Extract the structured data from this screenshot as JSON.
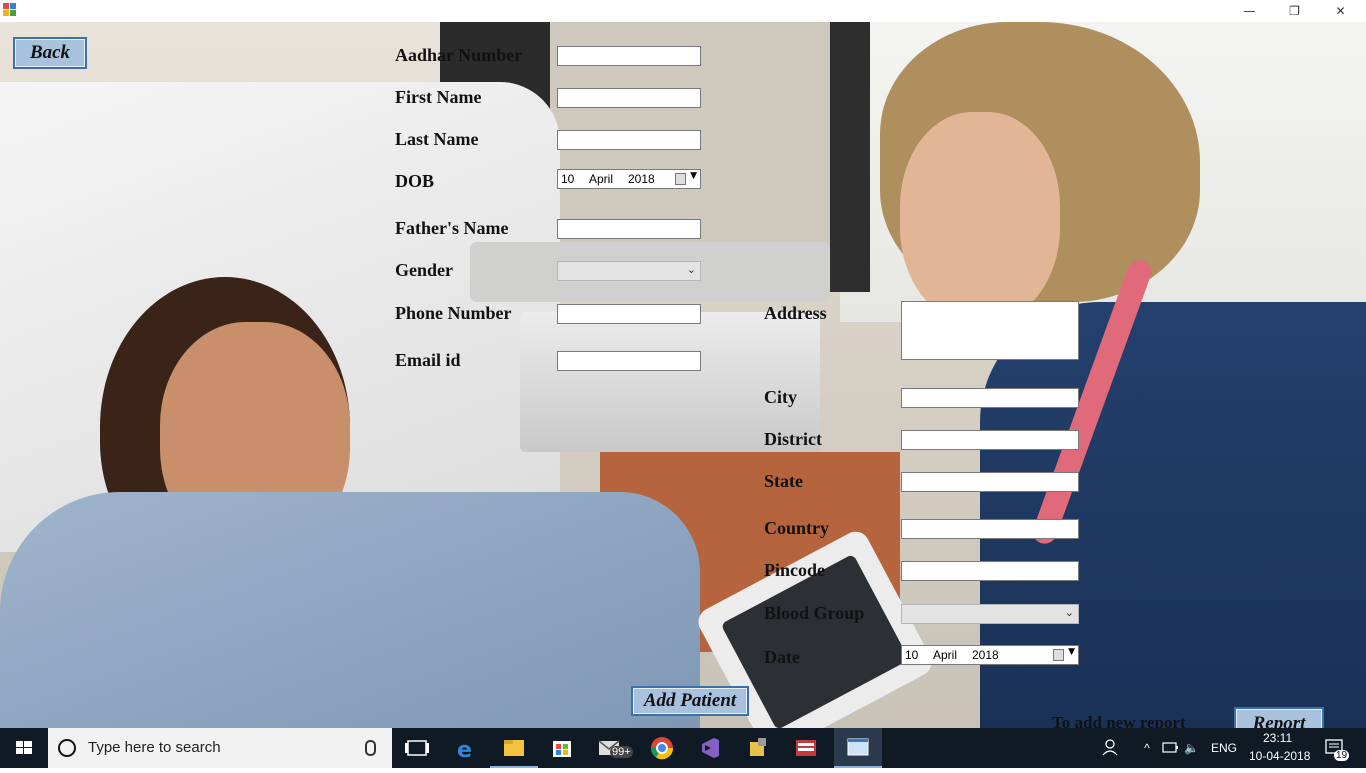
{
  "window": {
    "minimize_glyph": "—",
    "restore_glyph": "❐",
    "close_glyph": "✕"
  },
  "buttons": {
    "back": "Back",
    "add_patient": "Add Patient",
    "report": "Report"
  },
  "form_left": {
    "aadhar_label": "Aadhar Number",
    "first_name_label": "First Name",
    "last_name_label": "Last Name",
    "dob_label": "DOB",
    "dob_day": "10",
    "dob_month": "April",
    "dob_year": "2018",
    "fathers_name_label": "Father's Name",
    "gender_label": "Gender",
    "gender_value": "",
    "phone_label": "Phone Number",
    "email_label": "Email id"
  },
  "form_right": {
    "address_label": "Address",
    "city_label": "City",
    "district_label": "District",
    "state_label": "State",
    "country_label": "Country",
    "pincode_label": "Pincode",
    "blood_group_label": "Blood Group",
    "blood_group_value": "",
    "date_label": "Date",
    "date_day": "10",
    "date_month": "April",
    "date_year": "2018"
  },
  "footer_text": "To add new report",
  "taskbar": {
    "search_placeholder": "Type here to search",
    "mail_badge": "99+",
    "language": "ENG",
    "time": "23:11",
    "date": "10-04-2018",
    "notification_count": "19"
  },
  "colors": {
    "button_fill": "#a8c2de",
    "button_border": "#3d6fa8",
    "taskbar": "#0f1a24"
  }
}
